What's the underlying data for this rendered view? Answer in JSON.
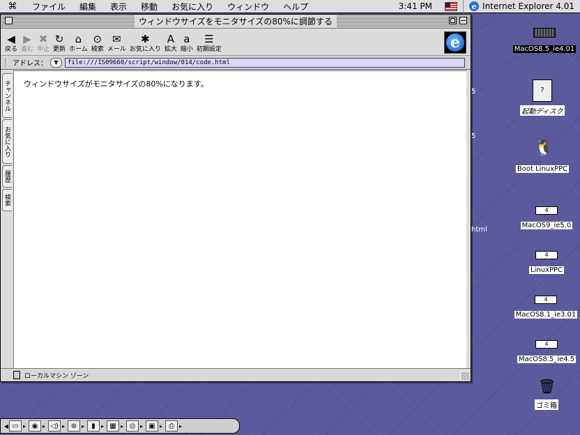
{
  "menubar": {
    "items": [
      "ファイル",
      "編集",
      "表示",
      "移動",
      "お気に入り",
      "ウィンドウ",
      "ヘルプ"
    ],
    "clock": "3:41 PM",
    "app_name": "Internet Explorer 4.01"
  },
  "window": {
    "title": "ウィンドウサイズをモニタサイズの80%に調節する",
    "toolbar": [
      {
        "name": "back",
        "label": "戻る",
        "icon": "◀",
        "disabled": false
      },
      {
        "name": "forward",
        "label": "進む",
        "icon": "▶",
        "disabled": true
      },
      {
        "name": "stop",
        "label": "中止",
        "icon": "✖",
        "disabled": true
      },
      {
        "name": "refresh",
        "label": "更新",
        "icon": "↻",
        "disabled": false
      },
      {
        "name": "home",
        "label": "ホーム",
        "icon": "⌂",
        "disabled": false
      },
      {
        "name": "search",
        "label": "検索",
        "icon": "⊙",
        "disabled": false
      },
      {
        "name": "mail",
        "label": "メール",
        "icon": "✉",
        "disabled": false
      },
      {
        "name": "favorites",
        "label": "お気に入り",
        "icon": "✱",
        "disabled": false
      },
      {
        "name": "larger",
        "label": "拡大",
        "icon": "A",
        "disabled": false
      },
      {
        "name": "smaller",
        "label": "縮小",
        "icon": "a",
        "disabled": false
      },
      {
        "name": "preferences",
        "label": "初期設定",
        "icon": "☰",
        "disabled": false
      }
    ],
    "address_label": "アドレス：",
    "address_value": "file:///IS09660/script/window/014/code.html",
    "side_tabs": [
      "チャンネル",
      "お気に入り",
      "履歴",
      "検索"
    ],
    "page_text": "ウィンドウサイズがモニタサイズの80%になります。",
    "status_text": "ローカルマシン ゾーン"
  },
  "desktop": {
    "items": [
      {
        "label": "MacOS8.5_ie4.01",
        "selected": true,
        "kind": "disk"
      },
      {
        "label": "起動ディスク",
        "selected": false,
        "kind": "doc"
      },
      {
        "label": "Boot LinuxPPC",
        "selected": false,
        "kind": "tux"
      },
      {
        "label": "MacOS9_ie5.0",
        "selected": false,
        "kind": "drive",
        "drive_text": "4"
      },
      {
        "label": "LinuxPPC",
        "selected": false,
        "kind": "drive",
        "drive_text": "4"
      },
      {
        "label": "MacOS8.1_ie3.01",
        "selected": false,
        "kind": "drive",
        "drive_text": "4"
      },
      {
        "label": "MacOS8.5_ie4.5",
        "selected": false,
        "kind": "drive",
        "drive_text": "4"
      },
      {
        "label": "ゴミ箱",
        "selected": false,
        "kind": "trash"
      }
    ],
    "partial_labels": [
      "5",
      "5",
      "html"
    ]
  },
  "control_strip": {
    "modules": [
      "monitor-icon",
      "microphone-icon",
      "speaker-icon",
      "cd-icon-red",
      "color-depth-icon",
      "resolution-icon",
      "cd-icon",
      "file-sharing-icon",
      "printer-icon"
    ]
  }
}
